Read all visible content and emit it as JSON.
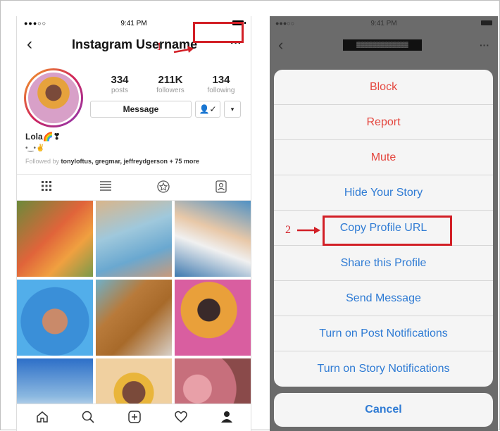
{
  "left": {
    "status": {
      "signal": "●●●○○",
      "time": "9:41 PM"
    },
    "nav": {
      "back": "‹",
      "title": "Instagram Username",
      "more": "···"
    },
    "annotation1": "1",
    "stats": [
      {
        "num": "334",
        "label": "posts"
      },
      {
        "num": "211K",
        "label": "followers"
      },
      {
        "num": "134",
        "label": "following"
      }
    ],
    "message_label": "Message",
    "follow_icon": "👤✓",
    "dropdown": "▾",
    "bio": {
      "name": "Lola🌈❣",
      "line2": "•‿•✌",
      "followed_prefix": "Followed by ",
      "followed_names": "tonyloftus, gregmar, jeffreydgerson",
      "followed_more": " + 75 more"
    },
    "tabs": [
      "grid-icon",
      "list-icon",
      "star-icon",
      "tagged-icon"
    ],
    "grid_colors": [
      [
        "#e0643a",
        "#9fc8dc",
        "#4f91c4"
      ],
      [
        "#52aeea",
        "#b87a3a",
        "#d95ea0"
      ],
      [
        "#8bb8e0",
        "#e9b53a",
        "#c76f7c"
      ]
    ],
    "bottom": [
      "home-icon",
      "search-icon",
      "add-icon",
      "heart-icon",
      "profile-icon"
    ]
  },
  "right": {
    "status": {
      "signal": "●●●○○",
      "time": "9:41 PM"
    },
    "nav": {
      "back": "‹",
      "title_redacted": "▒▒▒▒▒▒▒▒▒▒▒▒▒",
      "more": "···"
    },
    "annotation2": "2",
    "actions": [
      {
        "label": "Block",
        "color": "red"
      },
      {
        "label": "Report",
        "color": "red"
      },
      {
        "label": "Mute",
        "color": "red"
      },
      {
        "label": "Hide Your Story",
        "color": "blue"
      },
      {
        "label": "Copy Profile URL",
        "color": "blue"
      },
      {
        "label": "Share this Profile",
        "color": "blue"
      },
      {
        "label": "Send Message",
        "color": "blue"
      },
      {
        "label": "Turn on Post Notifications",
        "color": "blue"
      },
      {
        "label": "Turn on Story Notifications",
        "color": "blue"
      }
    ],
    "cancel_label": "Cancel"
  },
  "colors": {
    "annotation": "#d21f26",
    "ios_blue": "#2f7bd4",
    "ios_red": "#e4473f"
  }
}
